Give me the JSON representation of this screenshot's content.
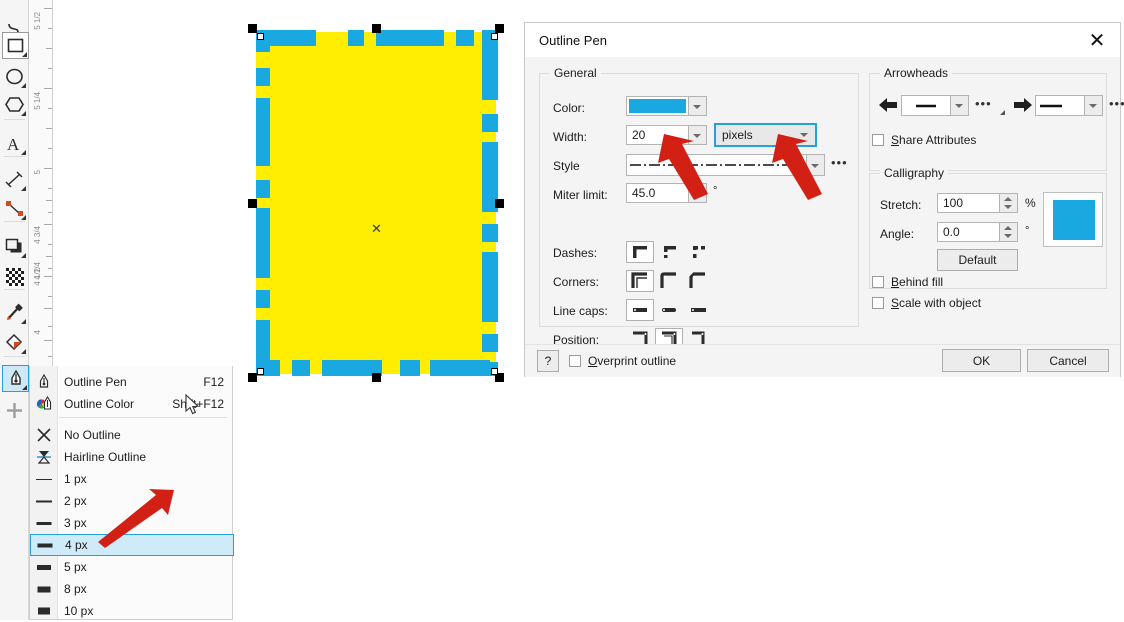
{
  "toolbar": {
    "tools": [
      {
        "name": "freehand-tool",
        "icon": "curve"
      },
      {
        "name": "rectangle-tool",
        "icon": "rect",
        "state": "boxed"
      },
      {
        "name": "ellipse-tool",
        "icon": "ellipse"
      },
      {
        "name": "polygon-tool",
        "icon": "polygon"
      },
      {
        "name": "text-tool",
        "icon": "text-A"
      },
      {
        "name": "dimension-tool",
        "icon": "dimension"
      },
      {
        "name": "connector-tool",
        "icon": "connector"
      },
      {
        "name": "drop-shadow-tool",
        "icon": "shadow"
      },
      {
        "name": "transparency-tool",
        "icon": "checker"
      },
      {
        "name": "color-eyedropper-tool",
        "icon": "eyedropper"
      },
      {
        "name": "interactive-fill-tool",
        "icon": "fill-bucket"
      },
      {
        "name": "outline-pen-tool",
        "icon": "pen-nib",
        "state": "selected"
      },
      {
        "name": "quick-customize-button",
        "icon": "plus"
      }
    ]
  },
  "ruler": {
    "unit": "inches",
    "labels": [
      "5 1/2",
      "5 1/4",
      "5",
      "4 3/4",
      "4 1/2",
      "4 1/4",
      "4"
    ]
  },
  "canvas": {
    "fill_color": "#ffee00",
    "outline_color": "#19a8e0",
    "outline_style": "dash-dot",
    "center_marker": "✕"
  },
  "flyout": {
    "items": [
      {
        "label": "Outline Pen",
        "shortcut": "F12",
        "icon": "pen-nib-icon",
        "highlighted": false
      },
      {
        "label": "Outline Color",
        "shortcut": "Shift+F12",
        "icon": "color-wheel-pen-icon",
        "highlighted": false
      },
      {
        "label": "No Outline",
        "shortcut": "",
        "icon": "x-icon",
        "highlighted": false
      },
      {
        "label": "Hairline Outline",
        "shortcut": "",
        "icon": "hairline-icon",
        "highlighted": false
      },
      {
        "label": "1 px",
        "shortcut": "",
        "icon": "line-1px-icon",
        "highlighted": false
      },
      {
        "label": "2 px",
        "shortcut": "",
        "icon": "line-2px-icon",
        "highlighted": false
      },
      {
        "label": "3 px",
        "shortcut": "",
        "icon": "line-3px-icon",
        "highlighted": false
      },
      {
        "label": "4 px",
        "shortcut": "",
        "icon": "line-4px-icon",
        "highlighted": true
      },
      {
        "label": "5 px",
        "shortcut": "",
        "icon": "line-5px-icon",
        "highlighted": false
      },
      {
        "label": "8 px",
        "shortcut": "",
        "icon": "line-8px-icon",
        "highlighted": false
      },
      {
        "label": "10 px",
        "shortcut": "",
        "icon": "line-10px-icon",
        "highlighted": false
      }
    ]
  },
  "dialog": {
    "title": "Outline Pen",
    "close_label": "✕",
    "general": {
      "legend": "General",
      "color_label": "Color:",
      "color_value": "#19a8e0",
      "width_label": "Width:",
      "width_value": "20",
      "units_value": "pixels",
      "style_label": "Style",
      "style_more": "•••",
      "miter_label": "Miter limit:",
      "miter_value": "45.0",
      "miter_unit": "°",
      "dashes_label": "Dashes:",
      "corners_label": "Corners:",
      "linecaps_label": "Line caps:",
      "position_label": "Position:"
    },
    "arrowheads": {
      "legend": "Arrowheads",
      "start_more": "•••",
      "end_more": "•••",
      "share_label": "Share Attributes",
      "share_checked": false
    },
    "calligraphy": {
      "legend": "Calligraphy",
      "stretch_label": "Stretch:",
      "stretch_value": "100",
      "stretch_unit": "%",
      "angle_label": "Angle:",
      "angle_value": "0.0",
      "angle_unit": "°",
      "default_label": "Default",
      "nib_color": "#19a8e0",
      "behind_fill_label": "Behind fill",
      "behind_fill_checked": false,
      "scale_label": "Scale with object",
      "scale_checked": false
    },
    "footer": {
      "help_label": "?",
      "overprint_label": "Overprint outline",
      "overprint_checked": false,
      "ok_label": "OK",
      "cancel_label": "Cancel"
    }
  },
  "annotations": {
    "arrow_color": "#d32015",
    "arrows": [
      "points-to-width-field",
      "points-to-units-dropdown",
      "points-to-4px-menu-item"
    ]
  }
}
